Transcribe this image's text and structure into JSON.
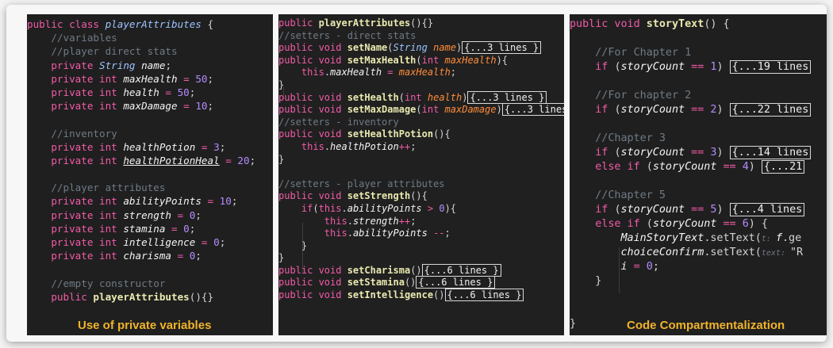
{
  "panel1": {
    "lines": [
      [
        [
          "k",
          "public class "
        ],
        [
          "t",
          "playerAttributes"
        ],
        [
          "p",
          " {"
        ]
      ],
      [
        [
          "p",
          "    "
        ],
        [
          "c",
          "//variables"
        ]
      ],
      [
        [
          "p",
          "    "
        ],
        [
          "c",
          "//player direct stats"
        ]
      ],
      [
        [
          "p",
          "    "
        ],
        [
          "k",
          "private "
        ],
        [
          "t",
          "String "
        ],
        [
          "v",
          "name"
        ],
        [
          "p",
          ";"
        ]
      ],
      [
        [
          "p",
          "    "
        ],
        [
          "k",
          "private int "
        ],
        [
          "v",
          "maxHealth"
        ],
        [
          "o",
          " = "
        ],
        [
          "n",
          "50"
        ],
        [
          "p",
          ";"
        ]
      ],
      [
        [
          "p",
          "    "
        ],
        [
          "k",
          "private int "
        ],
        [
          "v",
          "health"
        ],
        [
          "o",
          " = "
        ],
        [
          "n",
          "50"
        ],
        [
          "p",
          ";"
        ]
      ],
      [
        [
          "p",
          "    "
        ],
        [
          "k",
          "private int "
        ],
        [
          "v",
          "maxDamage"
        ],
        [
          "o",
          " = "
        ],
        [
          "n",
          "10"
        ],
        [
          "p",
          ";"
        ]
      ],
      [
        [
          "p",
          ""
        ]
      ],
      [
        [
          "p",
          "    "
        ],
        [
          "c",
          "//inventory"
        ]
      ],
      [
        [
          "p",
          "    "
        ],
        [
          "k",
          "private int "
        ],
        [
          "v",
          "healthPotion"
        ],
        [
          "o",
          " = "
        ],
        [
          "n",
          "3"
        ],
        [
          "p",
          ";"
        ]
      ],
      [
        [
          "p",
          "    "
        ],
        [
          "k",
          "private int "
        ],
        [
          "vu",
          "healthPotionHeal"
        ],
        [
          "o",
          " = "
        ],
        [
          "n",
          "20"
        ],
        [
          "p",
          ";"
        ]
      ],
      [
        [
          "p",
          ""
        ]
      ],
      [
        [
          "p",
          "    "
        ],
        [
          "c",
          "//player attributes"
        ]
      ],
      [
        [
          "p",
          "    "
        ],
        [
          "k",
          "private int "
        ],
        [
          "v",
          "abilityPoints"
        ],
        [
          "o",
          " = "
        ],
        [
          "n",
          "10"
        ],
        [
          "p",
          ";"
        ]
      ],
      [
        [
          "p",
          "    "
        ],
        [
          "k",
          "private int "
        ],
        [
          "v",
          "strength"
        ],
        [
          "o",
          " = "
        ],
        [
          "n",
          "0"
        ],
        [
          "p",
          ";"
        ]
      ],
      [
        [
          "p",
          "    "
        ],
        [
          "k",
          "private int "
        ],
        [
          "v",
          "stamina"
        ],
        [
          "o",
          " = "
        ],
        [
          "n",
          "0"
        ],
        [
          "p",
          ";"
        ]
      ],
      [
        [
          "p",
          "    "
        ],
        [
          "k",
          "private int "
        ],
        [
          "v",
          "intelligence"
        ],
        [
          "o",
          " = "
        ],
        [
          "n",
          "0"
        ],
        [
          "p",
          ";"
        ]
      ],
      [
        [
          "p",
          "    "
        ],
        [
          "k",
          "private int "
        ],
        [
          "v",
          "charisma"
        ],
        [
          "o",
          " = "
        ],
        [
          "n",
          "0"
        ],
        [
          "p",
          ";"
        ]
      ],
      [
        [
          "p",
          ""
        ]
      ],
      [
        [
          "p",
          "    "
        ],
        [
          "c",
          "//empty constructor"
        ]
      ],
      [
        [
          "p",
          "    "
        ],
        [
          "k",
          "public "
        ],
        [
          "f",
          "playerAttributes"
        ],
        [
          "p",
          "(){}"
        ]
      ]
    ],
    "caption": "Use of private variables"
  },
  "panel2": {
    "lines": [
      [
        [
          "k",
          "public "
        ],
        [
          "f",
          "playerAttributes"
        ],
        [
          "p",
          "(){}"
        ]
      ],
      [
        [
          "c",
          "//setters - direct stats"
        ]
      ],
      [
        [
          "k",
          "public void "
        ],
        [
          "f",
          "setName"
        ],
        [
          "p",
          "("
        ],
        [
          "t",
          "String "
        ],
        [
          "vo",
          "name"
        ],
        [
          "p",
          ")"
        ],
        [
          "fold",
          "{...3 lines }"
        ]
      ],
      [
        [
          "k",
          "public void "
        ],
        [
          "f",
          "setMaxHealth"
        ],
        [
          "p",
          "("
        ],
        [
          "k",
          "int "
        ],
        [
          "vo",
          "maxHealth"
        ],
        [
          "p",
          "){"
        ]
      ],
      [
        [
          "p",
          "    "
        ],
        [
          "k",
          "this"
        ],
        [
          "p",
          "."
        ],
        [
          "v",
          "maxHealth"
        ],
        [
          "o",
          " = "
        ],
        [
          "vo",
          "maxHealth"
        ],
        [
          "p",
          ";"
        ]
      ],
      [
        [
          "p",
          "}"
        ]
      ],
      [
        [
          "k",
          "public void "
        ],
        [
          "f",
          "setHealth"
        ],
        [
          "p",
          "("
        ],
        [
          "k",
          "int "
        ],
        [
          "vo",
          "health"
        ],
        [
          "p",
          ")"
        ],
        [
          "fold",
          "{...3 lines }"
        ]
      ],
      [
        [
          "k",
          "public void "
        ],
        [
          "f",
          "setMaxDamage"
        ],
        [
          "p",
          "("
        ],
        [
          "k",
          "int "
        ],
        [
          "vo",
          "maxDamage"
        ],
        [
          "p",
          ")"
        ],
        [
          "fold",
          "{...3 lines"
        ]
      ],
      [
        [
          "c",
          "//setters - inventory"
        ]
      ],
      [
        [
          "k",
          "public void "
        ],
        [
          "f",
          "setHealthPotion"
        ],
        [
          "p",
          "(){"
        ]
      ],
      [
        [
          "p",
          "    "
        ],
        [
          "k",
          "this"
        ],
        [
          "p",
          "."
        ],
        [
          "v",
          "healthPotion"
        ],
        [
          "o",
          "++"
        ],
        [
          "p",
          ";"
        ]
      ],
      [
        [
          "p",
          "}"
        ]
      ],
      [
        [
          "p",
          ""
        ]
      ],
      [
        [
          "c",
          "//setters - player attributes"
        ]
      ],
      [
        [
          "k",
          "public void "
        ],
        [
          "f",
          "setStrength"
        ],
        [
          "p",
          "(){"
        ]
      ],
      [
        [
          "p",
          "    "
        ],
        [
          "k",
          "if"
        ],
        [
          "p",
          "("
        ],
        [
          "k",
          "this"
        ],
        [
          "p",
          "."
        ],
        [
          "v",
          "abilityPoints"
        ],
        [
          "o",
          " > "
        ],
        [
          "n",
          "0"
        ],
        [
          "p",
          "){"
        ]
      ],
      [
        [
          "p",
          "        "
        ],
        [
          "k",
          "this"
        ],
        [
          "p",
          "."
        ],
        [
          "v",
          "strength"
        ],
        [
          "o",
          "++"
        ],
        [
          "p",
          ";"
        ]
      ],
      [
        [
          "p",
          "        "
        ],
        [
          "k",
          "this"
        ],
        [
          "p",
          "."
        ],
        [
          "v",
          "abilityPoints"
        ],
        [
          "o",
          " --"
        ],
        [
          "p",
          ";"
        ]
      ],
      [
        [
          "p",
          "    }"
        ]
      ],
      [
        [
          "p",
          "}"
        ]
      ],
      [
        [
          "k",
          "public void "
        ],
        [
          "f",
          "setCharisma"
        ],
        [
          "p",
          "()"
        ],
        [
          "fold",
          "{...6 lines }"
        ]
      ],
      [
        [
          "k",
          "public void "
        ],
        [
          "f",
          "setStamina"
        ],
        [
          "p",
          "()"
        ],
        [
          "fold",
          "{...6 lines }"
        ]
      ],
      [
        [
          "k",
          "public void "
        ],
        [
          "f",
          "setIntelligence"
        ],
        [
          "p",
          "()"
        ],
        [
          "fold",
          "{...6 lines }"
        ]
      ]
    ]
  },
  "panel3": {
    "lines": [
      [
        [
          "k",
          "public void "
        ],
        [
          "f",
          "storyText"
        ],
        [
          "p",
          "() {"
        ]
      ],
      [
        [
          "p",
          ""
        ]
      ],
      [
        [
          "p",
          "    "
        ],
        [
          "c",
          "//For Chapter 1"
        ]
      ],
      [
        [
          "p",
          "    "
        ],
        [
          "k",
          "if "
        ],
        [
          "p",
          "("
        ],
        [
          "v",
          "storyCount"
        ],
        [
          "o",
          " == "
        ],
        [
          "n",
          "1"
        ],
        [
          "p",
          ") "
        ],
        [
          "fold",
          "{...19 lines"
        ]
      ],
      [
        [
          "p",
          ""
        ]
      ],
      [
        [
          "p",
          "    "
        ],
        [
          "c",
          "//For chapter 2"
        ]
      ],
      [
        [
          "p",
          "    "
        ],
        [
          "k",
          "if "
        ],
        [
          "p",
          "("
        ],
        [
          "v",
          "storyCount"
        ],
        [
          "o",
          " == "
        ],
        [
          "n",
          "2"
        ],
        [
          "p",
          ") "
        ],
        [
          "fold",
          "{...22 lines"
        ]
      ],
      [
        [
          "p",
          ""
        ]
      ],
      [
        [
          "p",
          "    "
        ],
        [
          "c",
          "//Chapter 3"
        ]
      ],
      [
        [
          "p",
          "    "
        ],
        [
          "k",
          "if "
        ],
        [
          "p",
          "("
        ],
        [
          "v",
          "storyCount"
        ],
        [
          "o",
          " == "
        ],
        [
          "n",
          "3"
        ],
        [
          "p",
          ") "
        ],
        [
          "fold",
          "{...14 lines"
        ]
      ],
      [
        [
          "p",
          "    "
        ],
        [
          "k",
          "else if "
        ],
        [
          "p",
          "("
        ],
        [
          "v",
          "storyCount"
        ],
        [
          "o",
          " == "
        ],
        [
          "n",
          "4"
        ],
        [
          "p",
          ") "
        ],
        [
          "fold",
          "{...21"
        ]
      ],
      [
        [
          "p",
          ""
        ]
      ],
      [
        [
          "p",
          "    "
        ],
        [
          "c",
          "//Chapter 5"
        ]
      ],
      [
        [
          "p",
          "    "
        ],
        [
          "k",
          "if "
        ],
        [
          "p",
          "("
        ],
        [
          "v",
          "storyCount"
        ],
        [
          "o",
          " == "
        ],
        [
          "n",
          "5"
        ],
        [
          "p",
          ") "
        ],
        [
          "fold",
          "{...4 lines"
        ]
      ],
      [
        [
          "p",
          "    "
        ],
        [
          "k",
          "else if "
        ],
        [
          "p",
          "("
        ],
        [
          "v",
          "storyCount"
        ],
        [
          "o",
          " == "
        ],
        [
          "n",
          "6"
        ],
        [
          "p",
          ") {"
        ]
      ],
      [
        [
          "p",
          "        "
        ],
        [
          "v",
          "MainStoryText"
        ],
        [
          "p",
          ".setText("
        ],
        [
          "hint",
          "t: "
        ],
        [
          "v",
          "f"
        ],
        [
          "p",
          ".ge"
        ]
      ],
      [
        [
          "p",
          "        "
        ],
        [
          "v",
          "choiceConfirm"
        ],
        [
          "p",
          ".setText("
        ],
        [
          "hint",
          "text: "
        ],
        [
          "p",
          "\"R"
        ]
      ],
      [
        [
          "p",
          "        "
        ],
        [
          "v",
          "i"
        ],
        [
          "o",
          " = "
        ],
        [
          "n",
          "0"
        ],
        [
          "p",
          ";"
        ]
      ],
      [
        [
          "p",
          "    }"
        ]
      ],
      [
        [
          "p",
          ""
        ]
      ],
      [
        [
          "p",
          ""
        ]
      ],
      [
        [
          "p",
          "}"
        ]
      ]
    ],
    "caption": "Code Compartmentalization"
  }
}
